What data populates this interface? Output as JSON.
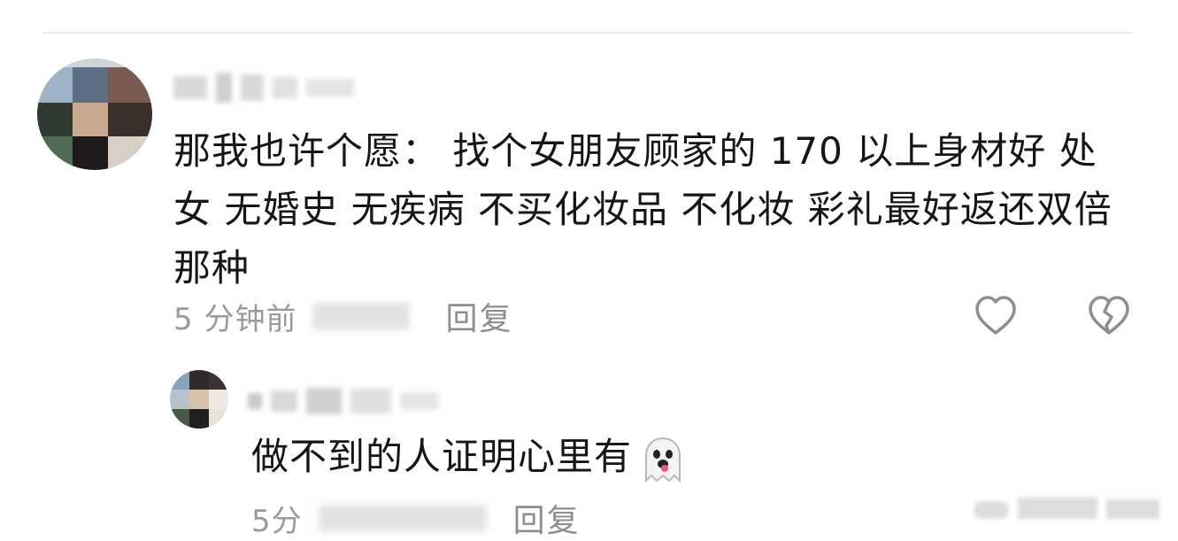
{
  "comment": {
    "text": "那我也许个愿： 找个女朋友顾家的 170 以上身材好  处女  无婚史 无疾病  不买化妆品 不化妆  彩礼最好返还双倍那种",
    "time": "5 分钟前",
    "reply_label": "回复"
  },
  "reply": {
    "text": "做不到的人证明心里有",
    "emoji": "ghost-emoji",
    "time": "5分",
    "reply_label": "回复"
  },
  "icons": {
    "like": "heart-icon",
    "dislike": "broken-heart-icon"
  },
  "colors": {
    "text": "#161616",
    "meta": "#9a9a9a",
    "icon": "#8e8e8e"
  }
}
